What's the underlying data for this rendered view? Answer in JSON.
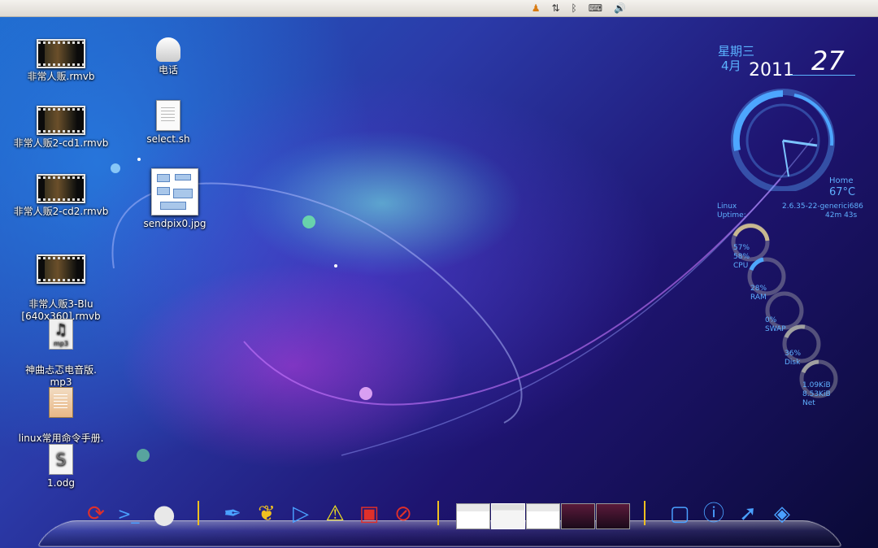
{
  "tray": {
    "qq_icon": "qq-penguin-icon",
    "network_icon": "network-arrows-icon",
    "bluetooth_icon": "bluetooth-icon",
    "keyboard_icon": "keyboard-icon",
    "volume_icon": "volume-icon"
  },
  "desktop": {
    "icons": [
      {
        "label": "非常人贩.rmvb",
        "type": "video"
      },
      {
        "label": "非常人贩2-cd1.rmvb",
        "type": "video"
      },
      {
        "label": "非常人贩2-cd2.rmvb",
        "type": "video"
      },
      {
        "label": "非常人贩3-Blu\n[640x360].rmvb",
        "type": "video"
      },
      {
        "label": "神曲忐忑电音版.\nmp3",
        "type": "mp3"
      },
      {
        "label": "linux常用命令手册.\nchm",
        "type": "chm"
      },
      {
        "label": "1.odg",
        "type": "odg"
      },
      {
        "label": "电话",
        "type": "phone"
      },
      {
        "label": "select.sh",
        "type": "script"
      },
      {
        "label": "sendpix0.jpg",
        "type": "image"
      }
    ],
    "mp3_glyph": "♫",
    "mp3_ext": "mp3",
    "odg_glyph": "S"
  },
  "conky": {
    "weekday": "星期三",
    "month": "4月",
    "year": "2011",
    "day": "27",
    "weather_location": "Home",
    "temperature": "67°C",
    "os_label": "Linux",
    "uptime_label": "Uptime:",
    "kernel": "2.6.35-22-generici686",
    "uptime": "42m 43s",
    "cpu": {
      "label": "CPU",
      "values": [
        "57%",
        "58%"
      ],
      "level": 0.57
    },
    "ram": {
      "label": "RAM",
      "value": "28%",
      "level": 0.28
    },
    "swap": {
      "label": "SWAP",
      "value": "0%",
      "level": 0.0
    },
    "disk": {
      "label": "Disk",
      "value": "36%",
      "level": 0.36
    },
    "net": {
      "label": "Net",
      "values": [
        "1.09KiB",
        "8.53KiB"
      ]
    }
  },
  "dock": {
    "left_items": [
      "refresh-icon",
      "terminal-icon",
      "apple-icon"
    ],
    "mid_items": [
      "pen-icon",
      "butterfly-icon",
      "play-icon",
      "warning-icon",
      "toolbox-icon",
      "browser-icon"
    ],
    "windows": [
      "chrome-window-1",
      "finder-window",
      "chrome-window-2",
      "terminal-window-1",
      "terminal-window-2"
    ],
    "right_items": [
      "frame-icon",
      "info-icon",
      "folder-arrow-icon",
      "upload-icon"
    ]
  },
  "colors": {
    "accent": "#5bb3ff",
    "panel": "#e8e5df"
  }
}
